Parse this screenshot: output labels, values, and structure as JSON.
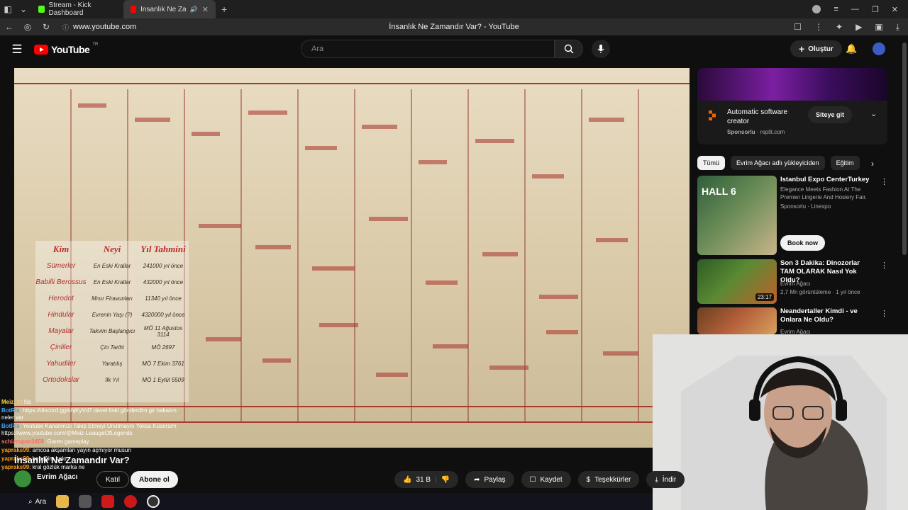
{
  "browser": {
    "tabs": [
      {
        "label": "Stream - Kick Dashboard",
        "favicon_color": "#53fc18"
      },
      {
        "label": "İnsanlık Ne Zamandı",
        "favicon_color": "#ff0000"
      }
    ],
    "url": "www.youtube.com",
    "page_title": "İnsanlık Ne Zamandır Var? - YouTube"
  },
  "header": {
    "logo": "YouTube",
    "region": "TR",
    "search_placeholder": "Ara",
    "create_label": "Oluştur"
  },
  "video": {
    "title": "İnsanlık Ne Zamandır Var?",
    "overlay_table": {
      "headers": [
        "Kim",
        "Neyi",
        "Yıl Tahmini"
      ],
      "rows": [
        {
          "kim": "Sümerler",
          "neyi": "En Eski Krallar",
          "yil": "241000 yıl önce"
        },
        {
          "kim": "Babilli Berossus",
          "neyi": "En Eski Krallar",
          "yil": "432000 yıl önce"
        },
        {
          "kim": "Herodot",
          "neyi": "Mısır Firavunları",
          "yil": "11340 yıl önce"
        },
        {
          "kim": "Hindular",
          "neyi": "Evrenin Yaşı (?)",
          "yil": "4320000 yıl önce"
        },
        {
          "kim": "Mayalar",
          "neyi": "Takvim Başlangıcı",
          "yil": "MÖ 11 Ağustos 3114"
        },
        {
          "kim": "Çinliler",
          "neyi": "Çin Tarihi",
          "yil": "MÖ 2697"
        },
        {
          "kim": "Yahudiler",
          "neyi": "Yaratılış",
          "yil": "MÖ 7 Ekim 3761"
        },
        {
          "kim": "Ortodokslar",
          "neyi": "İlk Yıl",
          "yil": "MÖ 1 Eylül 5509"
        }
      ]
    }
  },
  "chat": [
    {
      "user": "Meiz_Y",
      "text": ": !dc",
      "color": "#ffd34d"
    },
    {
      "user": "BotRix",
      "text": ": https://discord.gg/ohjKyVd7 davet linki gönderdim gir bakalım neler var",
      "color": "#3ea6ff"
    },
    {
      "user": "BotRix",
      "text": ": Youtube Kanalımızı Takip Etmeyi Unutmayın Yoksa Küsersim https://www.youtube.com/@Meiz-LeaugeOfLegends",
      "color": "#3ea6ff"
    },
    {
      "user": "schizropen3459",
      "text": ": Garen gameplay",
      "color": "#ff6b6b"
    },
    {
      "user": "yapraks99",
      "text": ": amcoa akşamları yayın açmıyor musun",
      "color": "#ff9f1a"
    },
    {
      "user": "yapraks99",
      "text": ": bebeğim kıdo",
      "color": "#ff9f1a"
    },
    {
      "user": "yapraks99",
      "text": ": kral gözlük marka ne",
      "color": "#ff9f1a"
    }
  ],
  "channel": {
    "name": "Evrim Ağacı",
    "join_label": "Katıl",
    "subscribe_label": "Abone ol"
  },
  "actions": {
    "likes": "31 B",
    "share": "Paylaş",
    "save": "Kaydet",
    "thanks": "Teşekkürler",
    "download": "İndir"
  },
  "taskbar": {
    "search_label": "Ara"
  },
  "ad": {
    "title": "Automatic software creator",
    "sponsor": "Sponsorlu",
    "domain": "replit.com",
    "button": "Siteye git"
  },
  "chips": [
    "Tümü",
    "Evrim Ağacı adlı yükleyiciden",
    "Eğitim"
  ],
  "recommendations": [
    {
      "title": "Istanbul Expo CenterTurkey",
      "line1": "Elegance Meets Fashion At The Premier Lingerie And Hosiery Fair.",
      "line2": "Sponsorlu · Linexpo",
      "button": "Book now",
      "thumb_color": "#2f5e3a"
    },
    {
      "title": "Son 3 Dakika: Dinozorlar TAM OLARAK Nasıl Yok Oldu?",
      "line1": "Evrim Ağacı",
      "line2": "2,7 Mn görüntüleme · 1 yıl önce",
      "duration": "23:17",
      "thumb_color": "#3a6b2a"
    },
    {
      "title": "Neandertaller Kimdi - ve Onlara Ne Oldu?",
      "line1": "Evrim Ağacı",
      "line2": "",
      "thumb_color": "#6a4020"
    }
  ]
}
